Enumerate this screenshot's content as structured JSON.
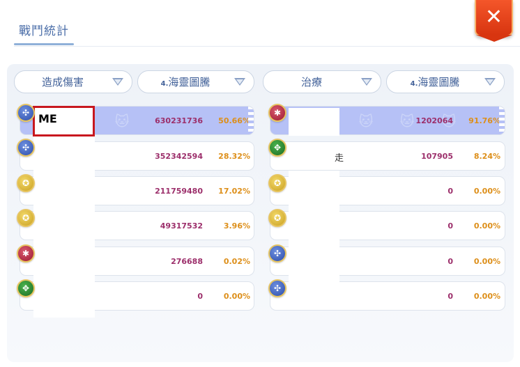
{
  "header": {
    "title": "戰鬥統計",
    "close_label": "✕"
  },
  "dropdowns": {
    "left_stat": "造成傷害",
    "left_item": "海靈圖騰",
    "left_item_prefix": "4.",
    "right_stat": "治療",
    "right_item": "海靈圖騰",
    "right_item_prefix": "4."
  },
  "overlay": {
    "me_label": "ME"
  },
  "damage_rows": [
    {
      "value": "630231736",
      "percent": "50.66%",
      "icon": "blue-class-icon",
      "fill": 0.5066
    },
    {
      "value": "352342594",
      "percent": "28.32%",
      "icon": "blue-class-icon",
      "fill": 0.2832
    },
    {
      "value": "211759480",
      "percent": "17.02%",
      "icon": "gold-class-icon",
      "fill": 0.1702
    },
    {
      "value": "49317532",
      "percent": "3.96%",
      "icon": "gold-class-icon",
      "fill": 0.0396
    },
    {
      "value": "276688",
      "percent": "0.02%",
      "icon": "red-class-icon",
      "fill": 0.0002
    },
    {
      "value": "0",
      "percent": "0.00%",
      "icon": "green-class-icon",
      "fill": 0
    }
  ],
  "heal_rows": [
    {
      "value": "1202064",
      "percent": "91.76%",
      "icon": "red-class-icon",
      "fill": 0.9176
    },
    {
      "value": "107905",
      "percent": "8.24%",
      "icon": "green-class-icon",
      "fill": 0.0824,
      "name_fragment": "走"
    },
    {
      "value": "0",
      "percent": "0.00%",
      "icon": "gold-class-icon",
      "fill": 0
    },
    {
      "value": "0",
      "percent": "0.00%",
      "icon": "gold-class-icon",
      "fill": 0
    },
    {
      "value": "0",
      "percent": "0.00%",
      "icon": "blue-class-icon",
      "fill": 0
    },
    {
      "value": "0",
      "percent": "0.00%",
      "icon": "blue-class-icon",
      "fill": 0
    }
  ],
  "colors": {
    "accent": "#4a6da8",
    "value_text": "#9c2f6b",
    "percent_text": "#dd8f1a",
    "highlight": "#b6c1f6",
    "close_button": "#e8461c"
  }
}
